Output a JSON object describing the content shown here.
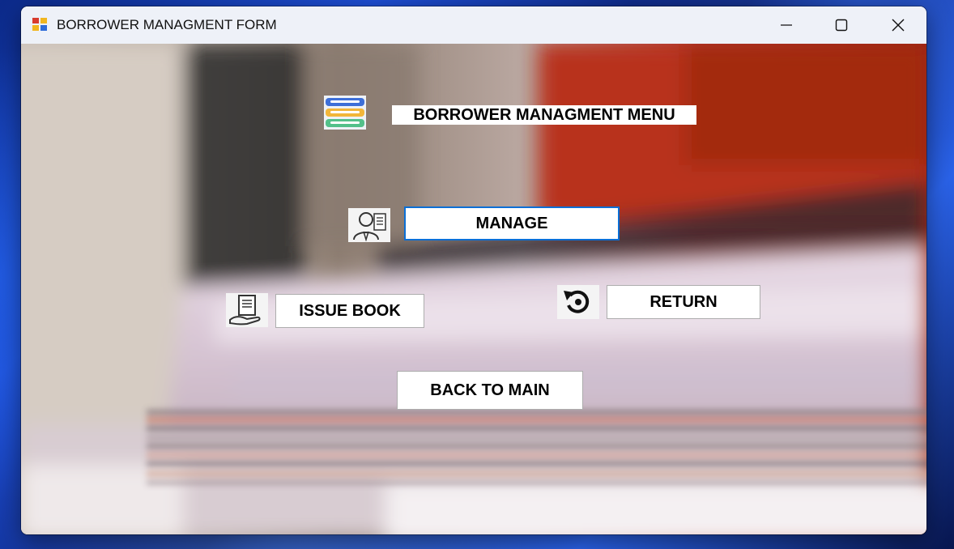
{
  "window": {
    "title": "BORROWER MANAGMENT FORM",
    "icon": "app-form-icon",
    "controls": [
      "minimize-icon",
      "maximize-icon",
      "close-icon"
    ]
  },
  "header": {
    "icon": "books-stack-icon",
    "label": "BORROWER MANAGMENT MENU"
  },
  "buttons": {
    "manage": {
      "label": "MANAGE",
      "icon": "user-contact-icon"
    },
    "issue_book": {
      "label": "ISSUE BOOK",
      "icon": "hand-document-icon"
    },
    "return": {
      "label": "RETURN",
      "icon": "undo-arrow-icon"
    },
    "back_to_main": {
      "label": "BACK TO MAIN"
    }
  },
  "colors": {
    "focus_border": "#0a6fd6",
    "button_bg": "#ffffff",
    "bg_orange": "#c8361a",
    "bg_dark": "#2e2e2e"
  }
}
